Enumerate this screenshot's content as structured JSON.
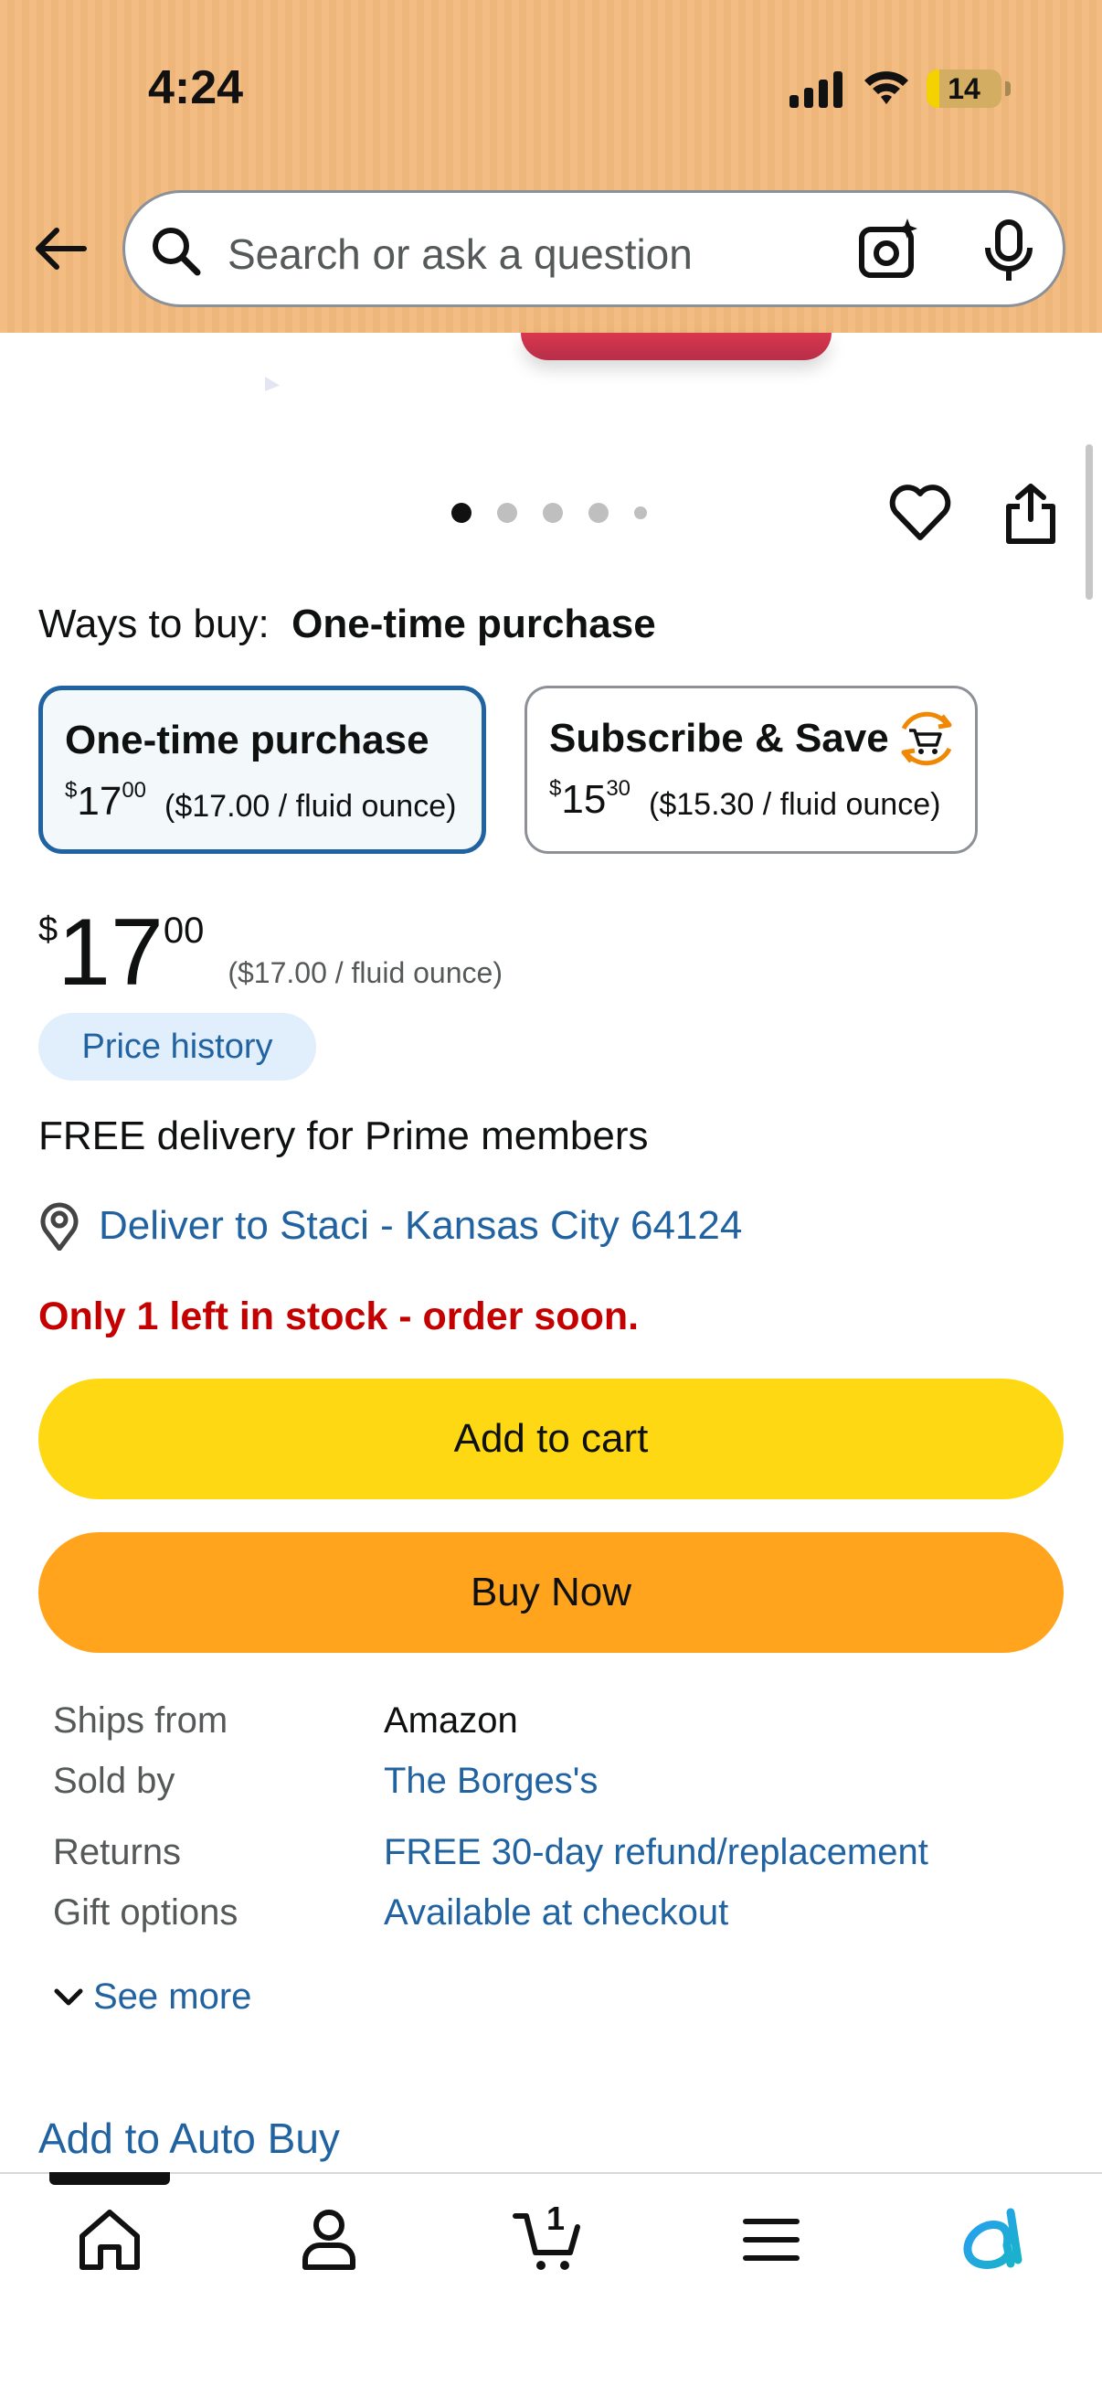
{
  "status_bar": {
    "time": "4:24",
    "battery": "14"
  },
  "search": {
    "placeholder": "Search or ask a question"
  },
  "carousel": {
    "count": 5,
    "active_index": 0
  },
  "ways_to_buy": {
    "label": "Ways to buy:",
    "selected": "One-time purchase"
  },
  "options": [
    {
      "title": "One-time purchase",
      "currency": "$",
      "dollars": "17",
      "cents": "00",
      "unit_price": "($17.00 / fluid ounce)"
    },
    {
      "title": "Subscribe & Save",
      "currency": "$",
      "dollars": "15",
      "cents": "30",
      "unit_price": "($15.30 / fluid ounce)"
    }
  ],
  "price": {
    "currency": "$",
    "dollars": "17",
    "cents": "00",
    "unit_price": "($17.00 / fluid ounce)"
  },
  "price_history_label": "Price history",
  "delivery": {
    "free_text": "FREE delivery for Prime members",
    "deliver_to": "Deliver to Staci - Kansas City 64124"
  },
  "stock_text": "Only 1 left in stock - order soon.",
  "buttons": {
    "add_to_cart": "Add to cart",
    "buy_now": "Buy Now"
  },
  "details": [
    {
      "key": "Ships from",
      "value": "Amazon"
    },
    {
      "key": "Sold by",
      "value": "The Borges's"
    },
    {
      "key": "Returns",
      "value": "FREE 30-day refund/replacement"
    },
    {
      "key": "Gift options",
      "value": "Available at checkout"
    }
  ],
  "see_more": "See more",
  "auto_buy": "Add to Auto Buy",
  "tabbar": {
    "cart_count": "1"
  },
  "colors": {
    "accent_link": "#2162a1",
    "cart_button": "#ffd814",
    "buy_button": "#ffa41c",
    "header": "#f2b97c",
    "stock_red": "#c40000"
  }
}
